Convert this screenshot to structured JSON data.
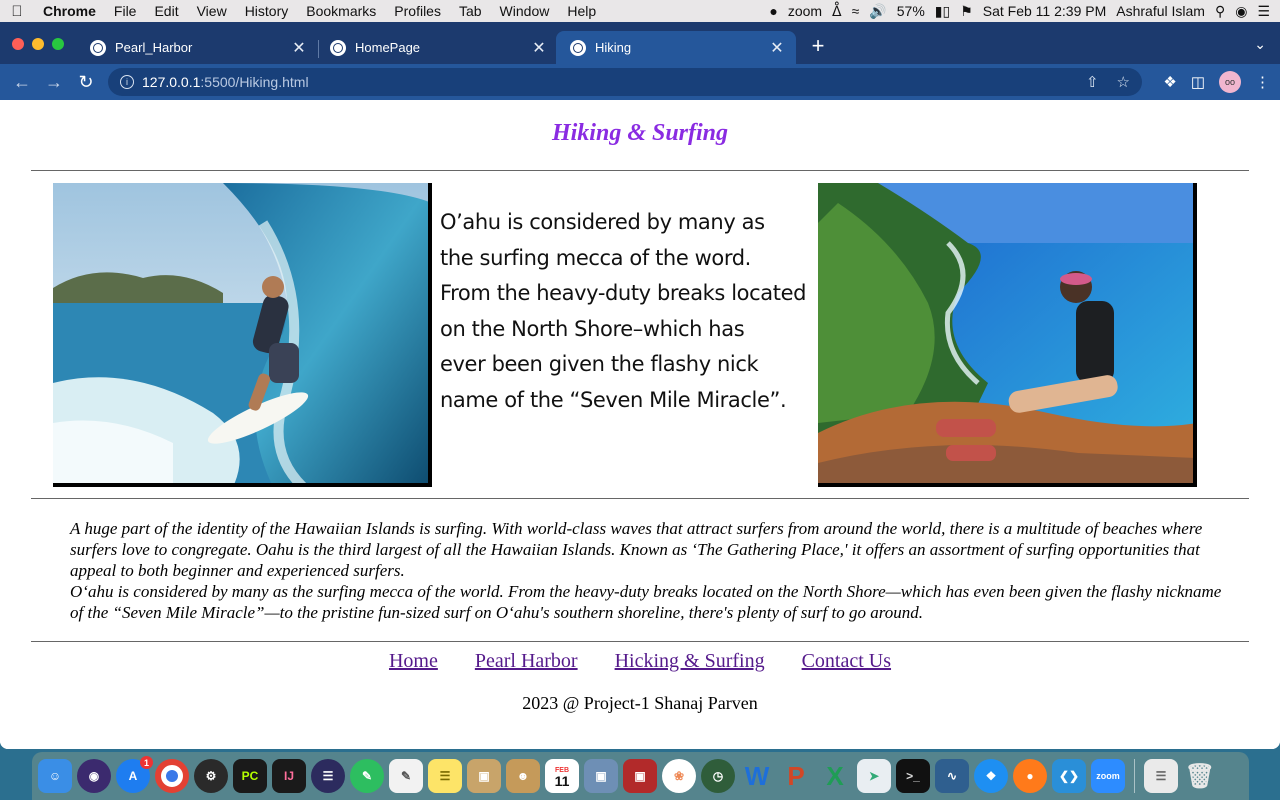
{
  "menubar": {
    "app_name": "Chrome",
    "items": [
      "File",
      "Edit",
      "View",
      "History",
      "Bookmarks",
      "Profiles",
      "Tab",
      "Window",
      "Help"
    ],
    "status": {
      "zoom": "zoom",
      "battery": "57%",
      "datetime": "Sat Feb 11  2:39 PM",
      "user": "Ashraful Islam"
    }
  },
  "browser": {
    "tabs": [
      {
        "title": "Pearl_Harbor"
      },
      {
        "title": "HomePage"
      },
      {
        "title": "Hiking"
      }
    ],
    "url_host": "127.0.0.1",
    "url_path": ":5500/Hiking.html"
  },
  "page": {
    "title": "Hiking & Surfing",
    "quote_lines": [
      "O’ahu is considered by many as",
      "the surfing mecca of the word.",
      "  From the heavy-duty breaks located",
      " on the North Shore–which has",
      " ever been given the flashy nick",
      "name of the “Seven Mile Miracle”."
    ],
    "paragraph_1": "A huge part of the identity of the Hawaiian Islands is surfing. With world-class waves that attract surfers from around the world, there is a multitude of beaches where surfers love to congregate. Oahu is the third largest of all the Hawaiian Islands. Known as ‘The Gathering Place,' it offers an assortment of surfing opportunities that appeal to both beginner and experienced surfers.",
    "paragraph_2": "O‘ahu is considered by many as the surfing mecca of the world. From the heavy-duty breaks located on the North Shore—which has even been given the flashy nickname of the “Seven Mile Miracle”—to the pristine fun-sized surf on O‘ahu's southern shoreline, there's plenty of surf to go around.",
    "nav": [
      "Home",
      "Pearl Harbor",
      "Hicking & Surfing",
      "Contact Us"
    ],
    "footer": "2023 @ Project-1 Shanaj Parven"
  },
  "dock": {
    "app_store_badge": "1",
    "calendar_month": "FEB",
    "calendar_day": "11",
    "zoom_label": "zoom"
  }
}
